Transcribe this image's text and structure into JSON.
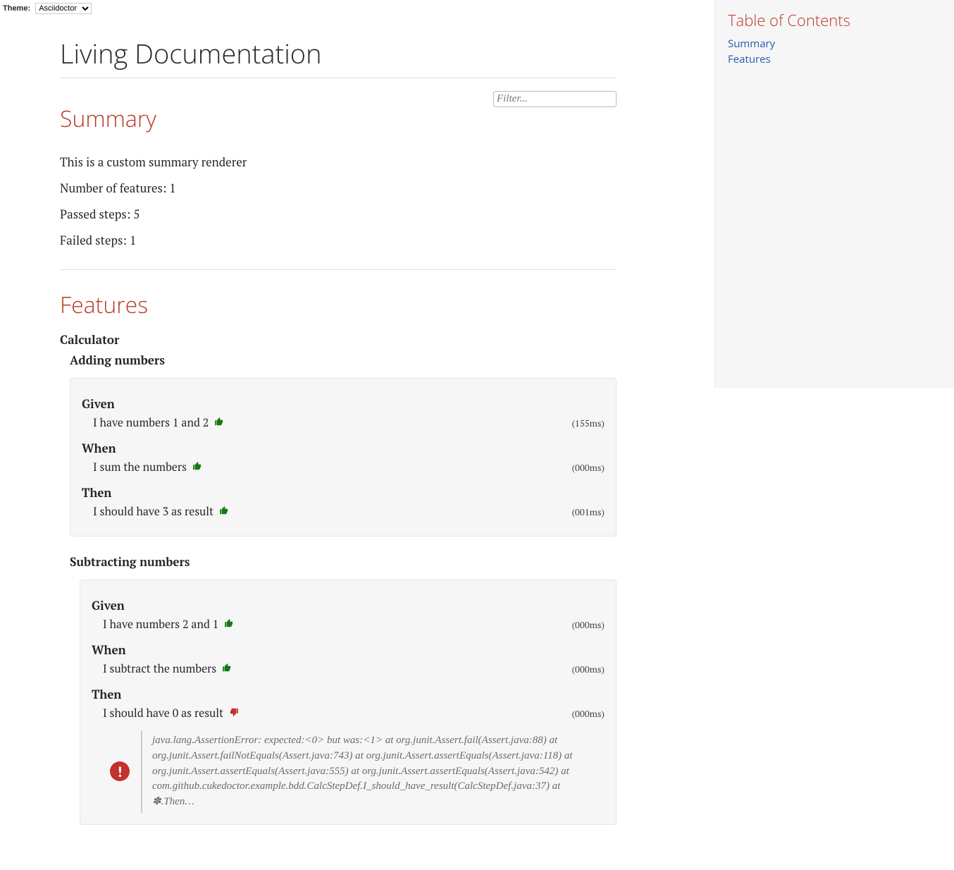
{
  "theme": {
    "label": "Theme:",
    "selected": "Asciidoctor",
    "options": [
      "Asciidoctor"
    ]
  },
  "header": {
    "title": "Living Documentation"
  },
  "toc": {
    "title": "Table of Contents",
    "items": [
      {
        "label": "Summary",
        "target": "#summary"
      },
      {
        "label": "Features",
        "target": "#features"
      }
    ]
  },
  "summary": {
    "heading": "Summary",
    "filter_placeholder": "Filter...",
    "lines": [
      "This is a custom summary renderer",
      "Number of features: 1",
      "Passed steps: 5",
      "Failed steps: 1"
    ]
  },
  "features_section": {
    "heading": "Features",
    "features": [
      {
        "name": "Calculator",
        "scenarios": [
          {
            "name": "Adding numbers",
            "steps": [
              {
                "keyword": "Given",
                "text": "I have numbers 1 and 2",
                "status": "pass",
                "time": "(155ms)"
              },
              {
                "keyword": "When",
                "text": "I sum the numbers",
                "status": "pass",
                "time": "(000ms)"
              },
              {
                "keyword": "Then",
                "text": "I should have 3 as result",
                "status": "pass",
                "time": "(001ms)"
              }
            ]
          },
          {
            "name": "Subtracting numbers",
            "steps": [
              {
                "keyword": "Given",
                "text": "I have numbers 2 and 1",
                "status": "pass",
                "time": "(000ms)"
              },
              {
                "keyword": "When",
                "text": "I subtract the numbers",
                "status": "pass",
                "time": "(000ms)"
              },
              {
                "keyword": "Then",
                "text": "I should have 0 as result",
                "status": "fail",
                "time": "(000ms)",
                "error": "java.lang.AssertionError: expected:<0> but was:<1> at org.junit.Assert.fail(Assert.java:88) at org.junit.Assert.failNotEquals(Assert.java:743) at org.junit.Assert.assertEquals(Assert.java:118) at org.junit.Assert.assertEquals(Assert.java:555) at org.junit.Assert.assertEquals(Assert.java:542) at com.github.cukedoctor.example.bdd.CalcStepDef.I_should_have_result(CalcStepDef.java:37) at ✽.Then…"
              }
            ]
          }
        ]
      }
    ]
  }
}
